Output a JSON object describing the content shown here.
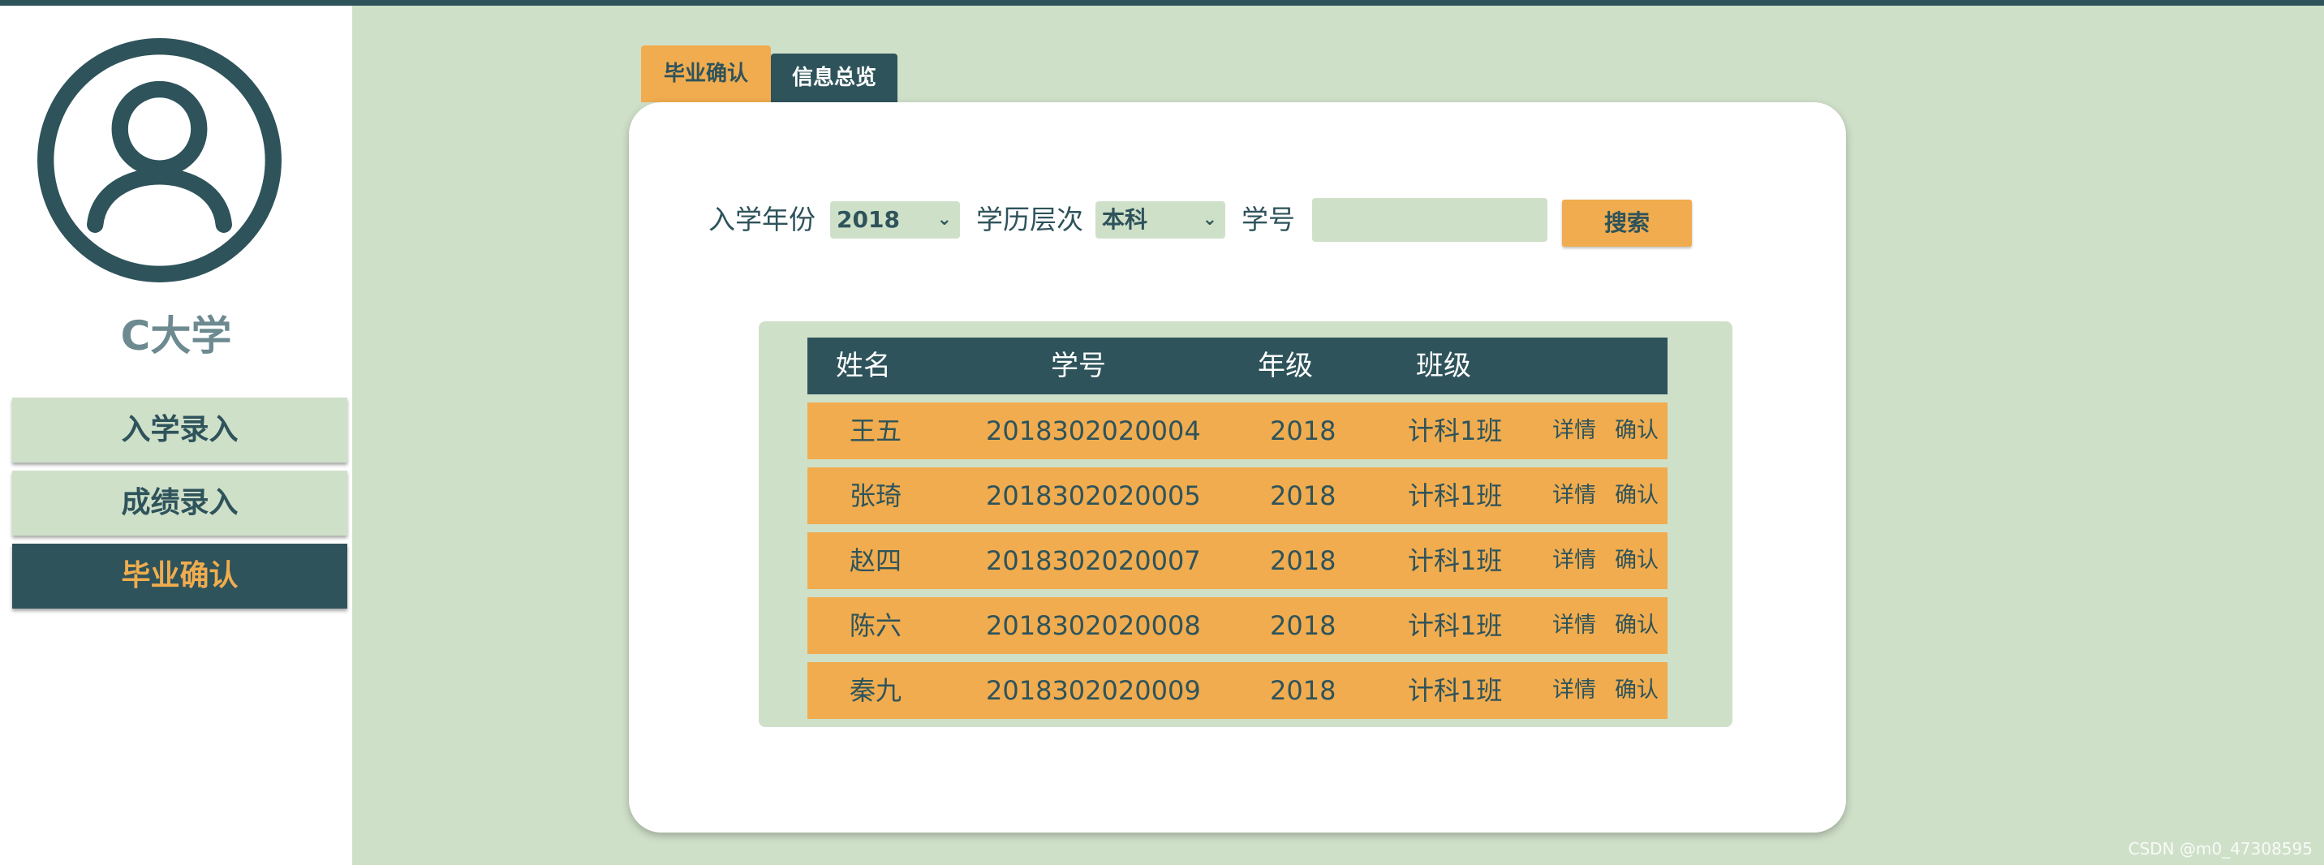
{
  "sidebar": {
    "school_name": "C大学",
    "nav": [
      {
        "label": "入学录入"
      },
      {
        "label": "成绩录入"
      },
      {
        "label": "毕业确认"
      }
    ]
  },
  "tabs": [
    {
      "label": "毕业确认"
    },
    {
      "label": "信息总览"
    }
  ],
  "filters": {
    "year_label": "入学年份",
    "year_value": "2018",
    "level_label": "学历层次",
    "level_value": "本科",
    "id_label": "学号",
    "id_value": "",
    "search_label": "搜索"
  },
  "table": {
    "headers": [
      "姓名",
      "学号",
      "年级",
      "班级"
    ],
    "detail_label": "详情",
    "confirm_label": "确认",
    "rows": [
      {
        "name": "王五",
        "id": "2018302020004",
        "grade": "2018",
        "class": "计科1班"
      },
      {
        "name": "张琦",
        "id": "2018302020005",
        "grade": "2018",
        "class": "计科1班"
      },
      {
        "name": "赵四",
        "id": "2018302020007",
        "grade": "2018",
        "class": "计科1班"
      },
      {
        "name": "陈六",
        "id": "2018302020008",
        "grade": "2018",
        "class": "计科1班"
      },
      {
        "name": "秦九",
        "id": "2018302020009",
        "grade": "2018",
        "class": "计科1班"
      }
    ]
  },
  "watermark": "CSDN @m0_47308595",
  "colors": {
    "primary": "#2e535b",
    "accent": "#f0ac4e",
    "panel": "#cfe0c9"
  },
  "icons": {
    "avatar": "user-circle-icon",
    "chevron": "chevron-down-icon"
  }
}
